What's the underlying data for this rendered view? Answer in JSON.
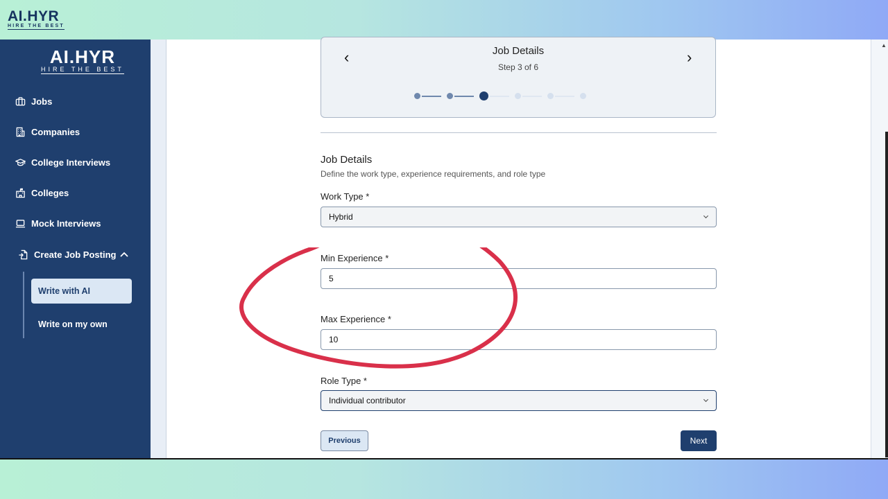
{
  "brand": {
    "name": "AI.HYR",
    "tagline": "HIRE  THE  BEST"
  },
  "sidebar": {
    "logo": {
      "name": "AI.HYR",
      "tagline": "HIRE  THE  BEST"
    },
    "items": [
      {
        "label": "Jobs",
        "icon": "briefcase-icon"
      },
      {
        "label": "Companies",
        "icon": "building-icon"
      },
      {
        "label": "College Interviews",
        "icon": "graduation-cap-icon"
      },
      {
        "label": "Colleges",
        "icon": "school-icon"
      },
      {
        "label": "Mock Interviews",
        "icon": "laptop-icon"
      },
      {
        "label": "Create Job Posting",
        "icon": "new-document-icon",
        "expanded": true
      }
    ],
    "subitems": [
      {
        "label": "Write with AI",
        "active": true
      },
      {
        "label": "Write on my own",
        "active": false
      }
    ]
  },
  "stepper": {
    "title": "Job Details",
    "subtitle": "Step 3 of 6",
    "current": 3,
    "total": 6
  },
  "form": {
    "title": "Job Details",
    "description": "Define the work type, experience requirements, and role type",
    "work_type": {
      "label": "Work Type *",
      "value": "Hybrid"
    },
    "min_experience": {
      "label": "Min Experience *",
      "value": "5"
    },
    "max_experience": {
      "label": "Max Experience *",
      "value": "10"
    },
    "role_type": {
      "label": "Role Type *",
      "value": "Individual contributor"
    }
  },
  "buttons": {
    "previous": "Previous",
    "next": "Next"
  },
  "colors": {
    "primary": "#1f3f6e",
    "annotation": "#d9304a",
    "accent_light": "#dbe7f4"
  }
}
